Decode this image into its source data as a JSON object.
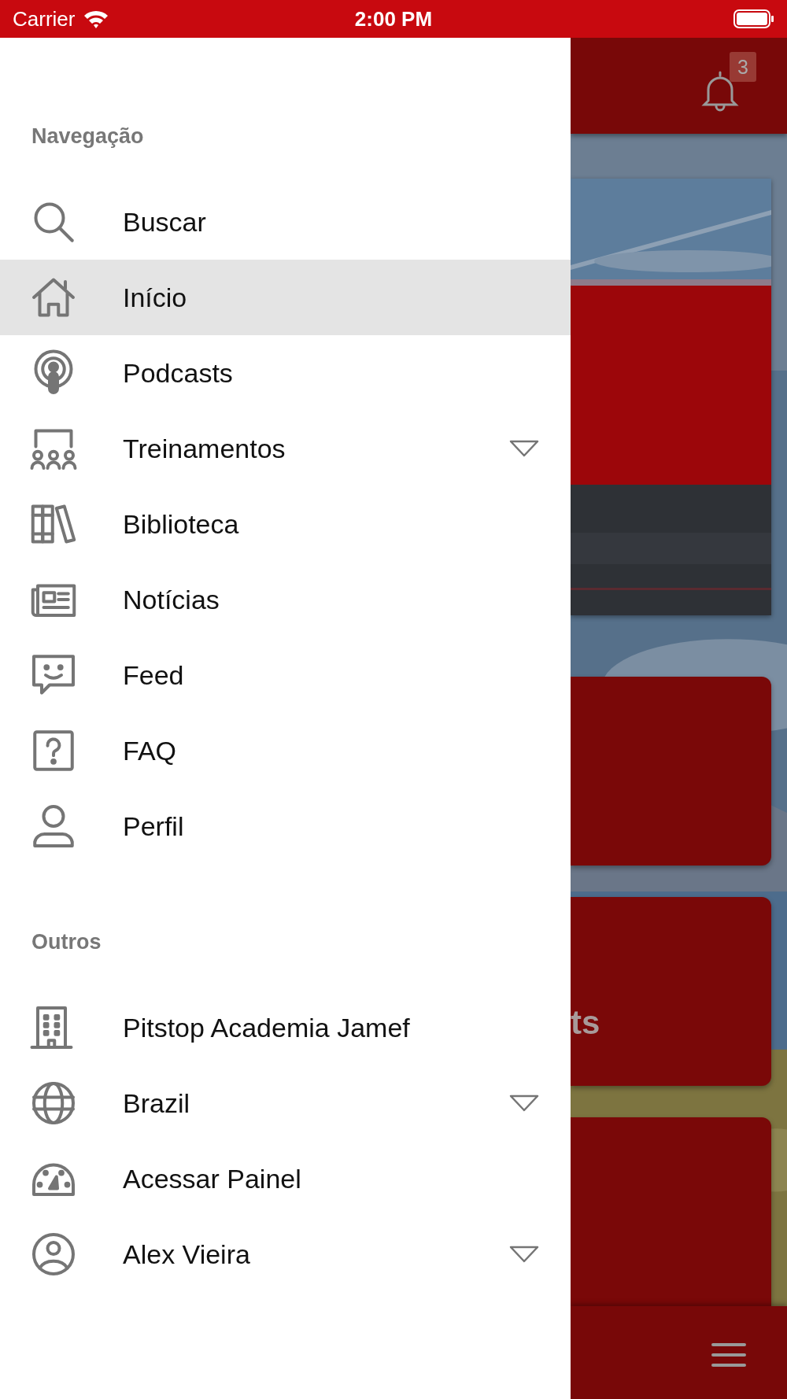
{
  "status_bar": {
    "carrier": "Carrier",
    "time": "2:00 PM"
  },
  "drawer": {
    "sections": [
      {
        "title": "Navegação",
        "items": [
          {
            "label": "Buscar",
            "selected": false,
            "expandable": false
          },
          {
            "label": "Início",
            "selected": true,
            "expandable": false
          },
          {
            "label": "Podcasts",
            "selected": false,
            "expandable": false
          },
          {
            "label": "Treinamentos",
            "selected": false,
            "expandable": true
          },
          {
            "label": "Biblioteca",
            "selected": false,
            "expandable": false
          },
          {
            "label": "Notícias",
            "selected": false,
            "expandable": false
          },
          {
            "label": "Feed",
            "selected": false,
            "expandable": false
          },
          {
            "label": "FAQ",
            "selected": false,
            "expandable": false
          },
          {
            "label": "Perfil",
            "selected": false,
            "expandable": false
          }
        ]
      },
      {
        "title": "Outros",
        "items": [
          {
            "label": "Pitstop Academia Jamef",
            "selected": false,
            "expandable": false
          },
          {
            "label": "Brazil",
            "selected": false,
            "expandable": true
          },
          {
            "label": "Acessar Painel",
            "selected": false,
            "expandable": false
          },
          {
            "label": "Alex Vieira",
            "selected": false,
            "expandable": true
          }
        ]
      }
    ]
  },
  "background": {
    "notification_count": "3",
    "cards": [
      {
        "kind": "blank"
      },
      {
        "kind": "titled",
        "label": "ts"
      },
      {
        "kind": "blank"
      }
    ]
  }
}
